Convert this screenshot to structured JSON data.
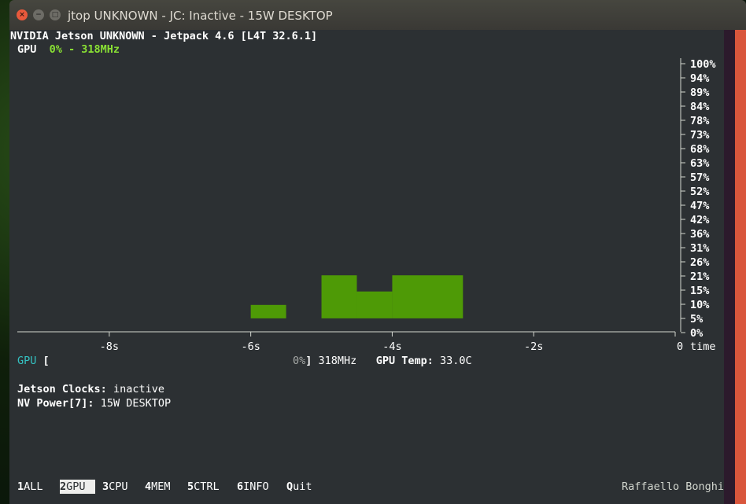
{
  "window": {
    "title": "jtop UNKNOWN - JC: Inactive - 15W DESKTOP",
    "close_glyph": "×",
    "min_glyph": "−",
    "max_glyph": "□"
  },
  "header": {
    "board": "NVIDIA Jetson UNKNOWN - Jetpack 4.6 [L4T 32.6.1]",
    "gpu_label": "GPU",
    "gpu_value": "0% - 318MHz"
  },
  "chart_data": {
    "type": "bar",
    "x_ticks": [
      "-8s",
      "-6s",
      "-4s",
      "-2s",
      "0"
    ],
    "x_unit": "time",
    "y_ticks": [
      "100%",
      "94%",
      "89%",
      "84%",
      "78%",
      "73%",
      "68%",
      "63%",
      "57%",
      "52%",
      "47%",
      "42%",
      "36%",
      "31%",
      "26%",
      "21%",
      "15%",
      "10%",
      "5%",
      "0%"
    ],
    "ylim": [
      0,
      100
    ],
    "xlim": [
      -9.3,
      0
    ],
    "bars": [
      {
        "x0": -6.0,
        "x1": -5.5,
        "y0": 5,
        "y1": 10
      },
      {
        "x0": -5.0,
        "x1": -4.5,
        "y0": 5,
        "y1": 21
      },
      {
        "x0": -4.5,
        "x1": -4.0,
        "y0": 5,
        "y1": 15
      },
      {
        "x0": -4.0,
        "x1": -3.0,
        "y0": 5,
        "y1": 21
      }
    ],
    "bar_color": "#4e9a06",
    "grid": false
  },
  "gpu_gauge": {
    "label": "GPU",
    "open": "[",
    "percent": "0%",
    "close": "]",
    "freq": "318MHz",
    "temp_label": "GPU Temp:",
    "temp_value": "33.0C"
  },
  "info": {
    "clocks_label": "Jetson Clocks:",
    "clocks_value": "inactive",
    "power_label": "NV Power[7]:",
    "power_value": "15W DESKTOP"
  },
  "statusbar": {
    "tabs": [
      {
        "key": "1",
        "label": "ALL",
        "active": false
      },
      {
        "key": "2",
        "label": "GPU",
        "active": true
      },
      {
        "key": "3",
        "label": "CPU",
        "active": false
      },
      {
        "key": "4",
        "label": "MEM",
        "active": false
      },
      {
        "key": "5",
        "label": "CTRL",
        "active": false
      },
      {
        "key": "6",
        "label": "INFO",
        "active": false
      }
    ],
    "quit_key": "Q",
    "quit_label": "uit",
    "author": "Raffaello Bonghi"
  },
  "colors": {
    "terminal_bg": "#2c3033",
    "accent": "#d9563c",
    "green": "#8ae234",
    "teal": "#34c2c2"
  }
}
